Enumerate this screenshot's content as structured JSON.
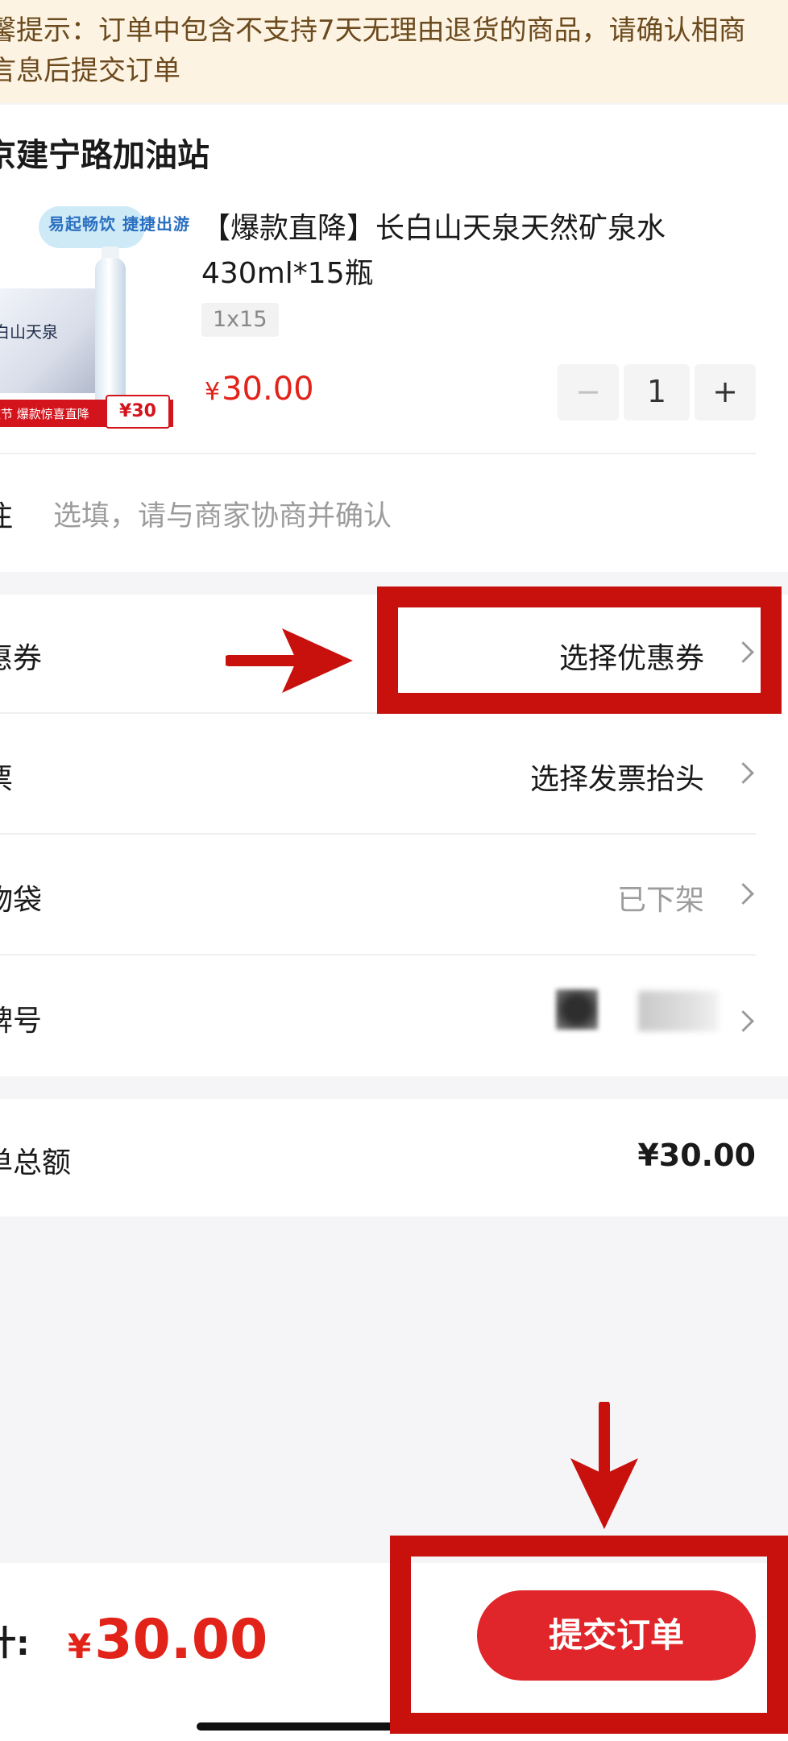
{
  "notice": {
    "line1": "馨提示：订单中包含不支持7天无理由退货的商品，请确认相商",
    "line2": "言息后提交订单"
  },
  "store": {
    "name": "京建宁路加油站",
    "product": {
      "title": "【爆款直降】长白山天泉天然矿泉水430ml*15瓶",
      "spec": "1x15",
      "price_symbol": "¥",
      "price": "30.00",
      "quantity": "1",
      "image": {
        "logo_text": "易起畅饮 捷捷出游",
        "box_text": "白山天泉",
        "promo_text": "款节 爆款惊喜直降",
        "promo_price": "¥30"
      }
    },
    "remark": {
      "label": "注",
      "placeholder": "选填，请与商家协商并确认"
    }
  },
  "options": [
    {
      "label": "惠券",
      "value": "选择优惠券",
      "muted": false
    },
    {
      "label": "票",
      "value": "选择发票抬头",
      "muted": false
    },
    {
      "label": "物袋",
      "value": "已下架",
      "muted": true
    },
    {
      "label": "牌号",
      "value": "",
      "muted": false
    }
  ],
  "total": {
    "label": "单总额",
    "value": "¥30.00"
  },
  "bottom_bar": {
    "sum_label": "计:",
    "sum_symbol": "¥",
    "sum_amount": "30.00",
    "submit_label": "提交订单"
  },
  "colors": {
    "accent_red": "#e2231a",
    "annotation_red": "#c8110c",
    "notice_bg": "#fdf3e2"
  }
}
